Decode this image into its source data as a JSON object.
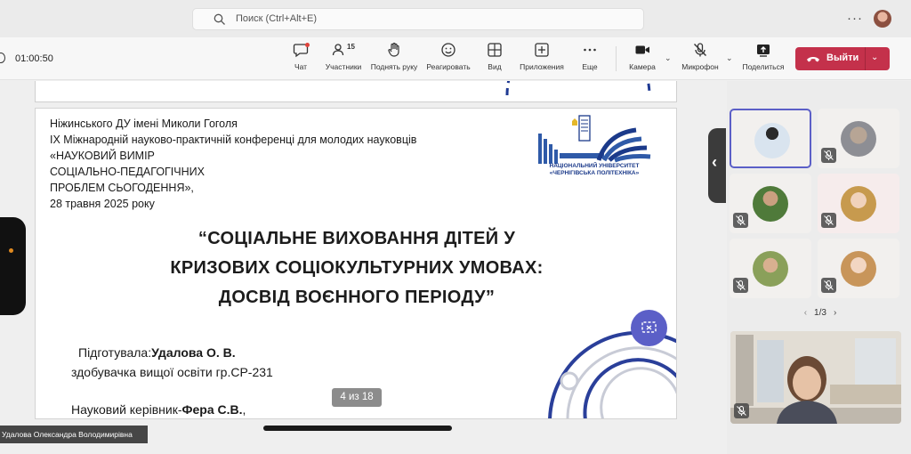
{
  "search": {
    "placeholder": "Поиск (Ctrl+Alt+E)",
    "icon": "search-icon"
  },
  "toolbar": {
    "timer": "01:00:50",
    "chat": "Чат",
    "participants": "Участники",
    "participants_count": "15",
    "raise_hand": "Поднять руку",
    "react": "Реагировать",
    "view": "Вид",
    "apps": "Приложения",
    "more": "Еще",
    "camera": "Камера",
    "mic": "Микрофон",
    "share": "Поделиться",
    "leave": "Выйти",
    "leave_color": "#c4314b",
    "accent": "#5b5fc7"
  },
  "slide": {
    "lines": [
      "Ніжинського ДУ імені Миколи Гоголя",
      "ІХ Міжнародній науково-практичній конференці для молодих науковців",
      "«НАУКОВИЙ ВИМІР",
      "СОЦІАЛЬНО-ПЕДАГОГІЧНИХ",
      "ПРОБЛЕМ СЬОГОДЕННЯ»,",
      "28 травня 2025 року"
    ],
    "title": [
      "“СОЦІАЛЬНЕ ВИХОВАННЯ ДІТЕЙ У",
      "КРИЗОВИХ СОЦІОКУЛЬТУРНИХ УМОВАХ:",
      "ДОСВІД ВОЄННОГО ПЕРІОДУ”"
    ],
    "prepared_label": "Підготувала:",
    "prepared_name": "Удалова О. В.",
    "student": "здобувачка вищої освіти гр.СР-231",
    "supervisor_label": "Науковий керівник-",
    "supervisor_name": "Фера С.В.",
    "supervisor_suffix": ",",
    "logo_text_1": "НАЦІОНАЛЬНИЙ УНІВЕРСИТЕТ",
    "logo_text_2": "«ЧЕРНІГІВСЬКА ПОЛІТЕХНІКА»"
  },
  "stage": {
    "page_counter": "4 из 18",
    "presenter_name": "Удалова Олександра Володимирівна"
  },
  "gallery": {
    "pager": "1/3"
  }
}
